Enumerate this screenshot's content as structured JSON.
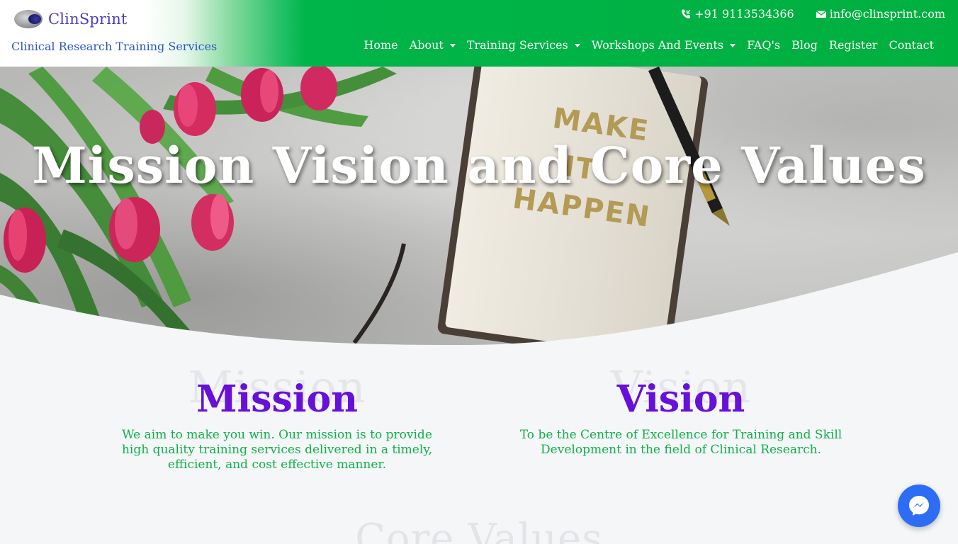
{
  "brand": {
    "name": "ClinSprint",
    "tagline": "Clinical Research Training Services"
  },
  "contact": {
    "phone": "+91 9113534366",
    "email": "info@clinsprint.com"
  },
  "nav": {
    "items": [
      {
        "label": "Home",
        "dropdown": false
      },
      {
        "label": "About",
        "dropdown": true
      },
      {
        "label": "Training Services",
        "dropdown": true
      },
      {
        "label": "Workshops And Events",
        "dropdown": true
      },
      {
        "label": "FAQ's",
        "dropdown": false
      },
      {
        "label": "Blog",
        "dropdown": false
      },
      {
        "label": "Register",
        "dropdown": false
      },
      {
        "label": "Contact",
        "dropdown": false
      }
    ]
  },
  "hero": {
    "title": "Mission Vision and Core Values"
  },
  "mission": {
    "ghost": "Mission",
    "title": "Mission",
    "text": "We aim to make you win. Our mission is to provide high quality training services delivered in a timely, efficient, and cost effective manner."
  },
  "vision": {
    "ghost": "Vision",
    "title": "Vision",
    "text": "To be the Centre of Excellence for Training and Skill Development in the field of Clinical Research."
  },
  "core_values": {
    "ghost": "Core Values"
  },
  "colors": {
    "header_green": "#00b03f",
    "brand_blue": "#4a3cc0",
    "heading_purple": "#6610d8",
    "text_green": "#0fb04a",
    "messenger_blue": "#2d6cf5"
  }
}
